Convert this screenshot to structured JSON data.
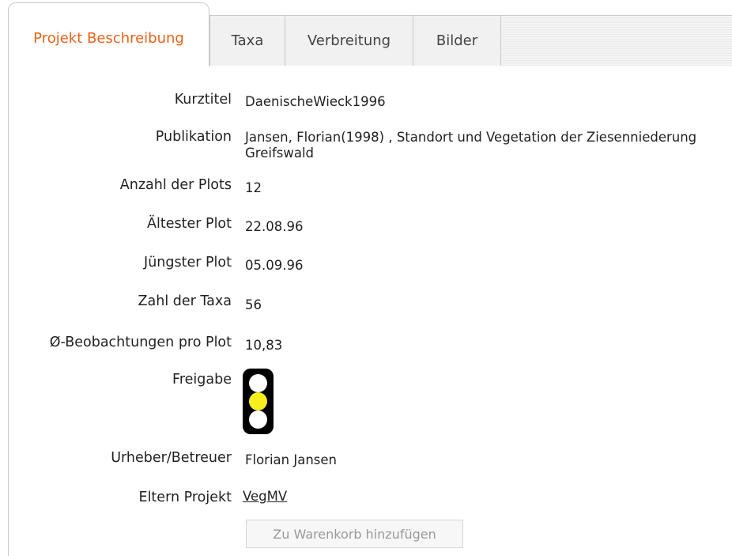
{
  "tabs": [
    {
      "label": "Projekt Beschreibung",
      "active": true
    },
    {
      "label": "Taxa",
      "active": false
    },
    {
      "label": "Verbreitung",
      "active": false
    },
    {
      "label": "Bilder",
      "active": false
    }
  ],
  "details": {
    "kurztitel": {
      "label": "Kurztitel",
      "value": "DaenischeWieck1996"
    },
    "publikation": {
      "label": "Publikation",
      "value_line1": "Jansen, Florian(1998) , Standort und Vegetation der Ziesenniederung",
      "value_line2": "Greifswald"
    },
    "anzahl_plots": {
      "label": "Anzahl der Plots",
      "value": "12"
    },
    "aeltester_plot": {
      "label": "Ältester Plot",
      "value": "22.08.96"
    },
    "juengster_plot": {
      "label": "Jüngster Plot",
      "value": "05.09.96"
    },
    "zahl_taxa": {
      "label": "Zahl der Taxa",
      "value": "56"
    },
    "beobachtungen": {
      "label": "Ø-Beobachtungen pro Plot",
      "value": "10,83"
    },
    "freigabe": {
      "label": "Freigabe",
      "status": "yellow",
      "colors": {
        "active": "#f6ef1d",
        "inactive": "#ffffff",
        "housing": "#000000"
      }
    },
    "urheber": {
      "label": "Urheber/Betreuer",
      "value": "Florian Jansen"
    },
    "eltern_projekt": {
      "label": "Eltern Projekt",
      "value": "VegMV"
    }
  },
  "actions": {
    "cart_button": "Zu Warenkorb hinzufügen"
  },
  "colors": {
    "active_tab_text": "#e8621a",
    "border": "#c9c9c9"
  }
}
